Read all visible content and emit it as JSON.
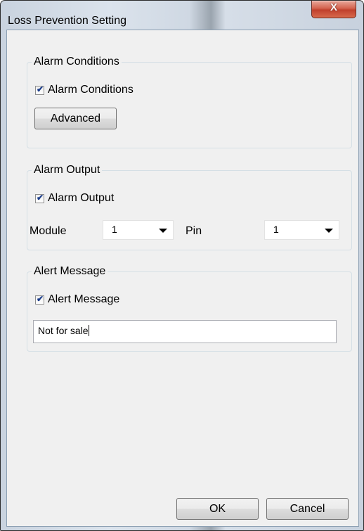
{
  "window": {
    "title": "Loss Prevention Setting",
    "close_label": "X"
  },
  "alarm_conditions": {
    "group_label": "Alarm Conditions",
    "checkbox_label": "Alarm Conditions",
    "checked": true,
    "advanced_label": "Advanced"
  },
  "alarm_output": {
    "group_label": "Alarm Output",
    "checkbox_label": "Alarm Output",
    "checked": true,
    "module_label": "Module",
    "module_value": "1",
    "pin_label": "Pin",
    "pin_value": "1"
  },
  "alert_message": {
    "group_label": "Alert Message",
    "checkbox_label": "Alert Message",
    "checked": true,
    "message_value": "Not for sale"
  },
  "footer": {
    "ok_label": "OK",
    "cancel_label": "Cancel"
  },
  "icons": {
    "check": "checkmark-icon",
    "dropdown": "dropdown-arrow-icon"
  }
}
